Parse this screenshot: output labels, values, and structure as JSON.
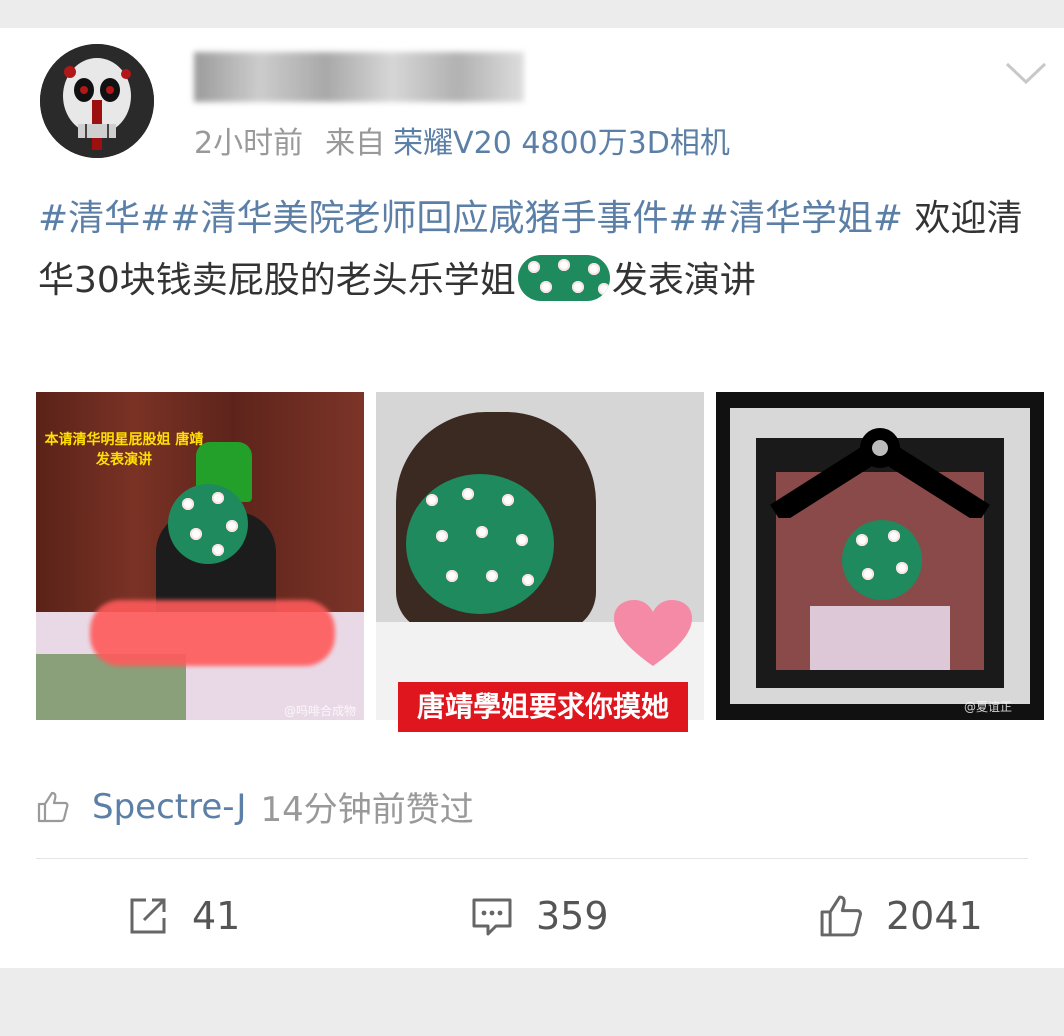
{
  "post": {
    "author": {
      "avatar_icon": "skull-avatar-icon"
    },
    "meta": {
      "time": "2小时前",
      "from_label": "来自",
      "device": "荣耀V20 4800万3D相机"
    },
    "text": {
      "tags": [
        "#清华#",
        "#清华美院老师回应咸猪手事件#",
        "#清华学姐#"
      ],
      "body_before": " 欢迎清华30块钱卖屁股的老头乐学姐",
      "body_after": "发表演讲"
    },
    "images": [
      {
        "overlay_text": "本请清华明星屁股姐 唐靖发表演讲",
        "watermark": "@吗啡合成物激素"
      },
      {
        "caption": "唐靖學姐要求你摸她"
      },
      {
        "watermark": "@夏谊正"
      }
    ],
    "liked_by": {
      "user": "Spectre-J",
      "time": "14分钟前赞过"
    },
    "actions": {
      "share_count": "41",
      "comment_count": "359",
      "like_count": "2041"
    }
  },
  "colors": {
    "link": "#5b7fa6",
    "meta_gray": "#999999",
    "sticker_green": "#1e8a5e",
    "caption_red": "#e0161f"
  }
}
